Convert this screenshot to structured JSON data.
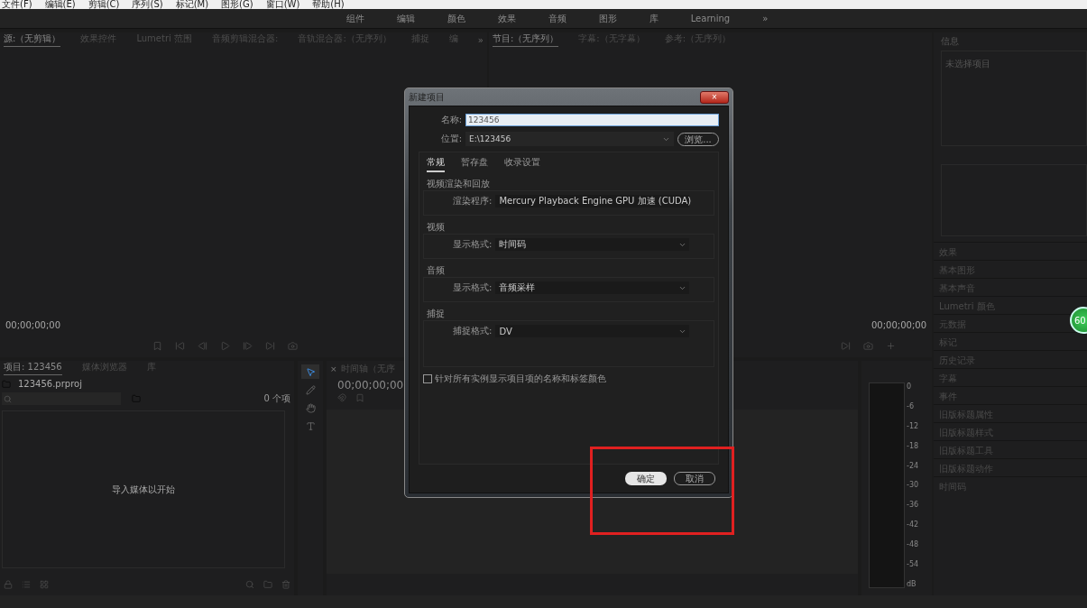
{
  "menu_bar": [
    "文件(F)",
    "编辑(E)",
    "剪辑(C)",
    "序列(S)",
    "标记(M)",
    "图形(G)",
    "窗口(W)",
    "帮助(H)"
  ],
  "workspace_tabs": [
    {
      "label": "组件",
      "selected": false
    },
    {
      "label": "编辑",
      "selected": false
    },
    {
      "label": "颜色",
      "selected": false
    },
    {
      "label": "效果",
      "selected": false
    },
    {
      "label": "音频",
      "selected": false
    },
    {
      "label": "图形",
      "selected": false
    },
    {
      "label": "库",
      "selected": false
    },
    {
      "label": "Learning",
      "selected": false
    }
  ],
  "workspace_more": "»",
  "source_panel": {
    "tabs": [
      {
        "label": "源:（无剪辑）",
        "selected": true
      },
      {
        "label": "效果控件",
        "selected": false
      },
      {
        "label": "Lumetri 范围",
        "selected": false
      },
      {
        "label": "音频剪辑混合器:",
        "selected": false
      },
      {
        "label": "音轨混合器:（无序列）",
        "selected": false
      },
      {
        "label": "捕捉",
        "selected": false
      },
      {
        "label": "编",
        "selected": false
      }
    ],
    "more": "»",
    "timecode": "00;00;00;00"
  },
  "program_panel": {
    "tabs": [
      {
        "label": "节目:（无序列）",
        "selected": true
      },
      {
        "label": "字幕:（无字幕）",
        "selected": false
      },
      {
        "label": "参考:（无序列）",
        "selected": false
      }
    ],
    "timecode": "00;00;00;00"
  },
  "info_panel": {
    "title": "信息",
    "message": "未选择项目"
  },
  "right_panels": [
    "效果",
    "基本图形",
    "基本声音",
    "Lumetri 颜色",
    "元数据",
    "标记",
    "历史记录",
    "字幕",
    "事件",
    "旧版标题属性",
    "旧版标题样式",
    "旧版标题工具",
    "旧版标题动作",
    "时间码"
  ],
  "project_panel": {
    "tabs": [
      {
        "label": "项目: 123456",
        "selected": true
      },
      {
        "label": "媒体浏览器",
        "selected": false
      },
      {
        "label": "库",
        "selected": false
      }
    ],
    "file": "123456.prproj",
    "count": "0 个项",
    "empty_message": "导入媒体以开始"
  },
  "timeline": {
    "title": "时间轴（无序",
    "close": "×",
    "timecode": "00;00;00;00"
  },
  "meter_scale": [
    "0",
    "-6",
    "-12",
    "-18",
    "-24",
    "-30",
    "-36",
    "-42",
    "-48",
    "-54",
    "dB"
  ],
  "badge": "60",
  "dialog": {
    "title": "新建项目",
    "close": "×",
    "name_label": "名称:",
    "name_value": "123456",
    "location_label": "位置:",
    "location_value": "E:\\123456",
    "browse": "浏览...",
    "tabs": [
      {
        "label": "常规",
        "selected": true
      },
      {
        "label": "暂存盘",
        "selected": false
      },
      {
        "label": "收录设置",
        "selected": false
      }
    ],
    "sections": [
      {
        "title": "视频渲染和回放",
        "label": "渲染程序:",
        "value": "Mercury Playback Engine GPU 加速 (CUDA)"
      },
      {
        "title": "视频",
        "label": "显示格式:",
        "value": "时间码"
      },
      {
        "title": "音频",
        "label": "显示格式:",
        "value": "音频采样"
      },
      {
        "title": "捕捉",
        "label": "捕捉格式:",
        "value": "DV"
      }
    ],
    "checkbox": {
      "label": "针对所有实例显示项目项的名称和标签颜色",
      "checked": false
    },
    "ok": "确定",
    "cancel": "取消"
  }
}
